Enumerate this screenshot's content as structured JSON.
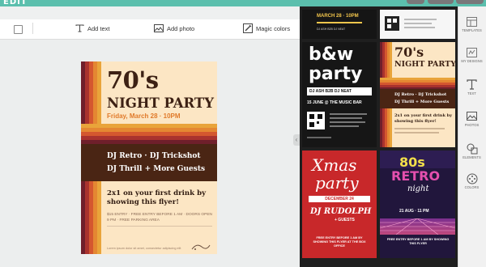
{
  "app": {
    "logo": "EDIT"
  },
  "toolbar": {
    "add_text": "Add text",
    "add_photo": "Add photo",
    "magic_colors": "Magic colors"
  },
  "flyer": {
    "title_line1": "70's",
    "title_line2": "NIGHT PARTY",
    "date": "Friday, March 28 · 10PM",
    "djs_line1": "DJ Retro · DJ Trickshot",
    "djs_line2": "DJ Thrill + More Guests",
    "offer": "2x1 on your first drink by showing this flyer!",
    "fine_print": "$15 ENTRY · FREE ENTRY BEFORE 1 AM · DOORS OPEN 9 PM · FREE PARKING AREA",
    "footer": "Lorem ipsum dolor sit amet, consectetur adipiscing elit",
    "colors": {
      "background": "#fce6c4",
      "brown": "#4a2514",
      "orange": "#e07a2a",
      "stripes": [
        "#e9a43a",
        "#e48732",
        "#d4572f",
        "#a9322e",
        "#6f1f2b"
      ]
    }
  },
  "templates": {
    "t1": {
      "date": "MARCH 28 · 10PM",
      "sub": "DJ ASH B2B DJ NEAT"
    },
    "t2": {
      "title": "b&w party",
      "dj": "DJ ASH B2B DJ NEAT",
      "date": "15 JUNE @ THE MUSIC BAR"
    },
    "t3": {
      "title1": "70's",
      "title2": "NIGHT PARTY",
      "djs_line1": "DJ Retro · DJ Trickshot",
      "djs_line2": "DJ Thrill + More Guests",
      "offer": "2x1 on your first drink by showing this flyer!"
    },
    "t4": {
      "title1": "Xmas",
      "title2": "party",
      "date": "DECEMBER 24",
      "dj": "DJ RUDOLPH",
      "guests": "+ GUESTS",
      "footer": "FREE ENTRY BEFORE 1 AM BY SHOWING THIS FLYER AT THE BOX OFFICE"
    },
    "t5": {
      "title1": "80s",
      "title2": "RETRO",
      "title3": "night",
      "date": "21 AUG · 11 PM",
      "footer": "FREE ENTRY BEFORE 1 AM BY SHOWING THIS FLYER"
    }
  },
  "sidebar": {
    "items": [
      {
        "label": "TEMPLATES",
        "icon": "templates-icon"
      },
      {
        "label": "MY DESIGNS",
        "icon": "my-designs-icon"
      },
      {
        "label": "TEXT",
        "icon": "text-icon"
      },
      {
        "label": "PHOTOS",
        "icon": "photos-icon"
      },
      {
        "label": "ELEMENTS",
        "icon": "elements-icon"
      },
      {
        "label": "COLORS",
        "icon": "colors-icon"
      }
    ]
  }
}
